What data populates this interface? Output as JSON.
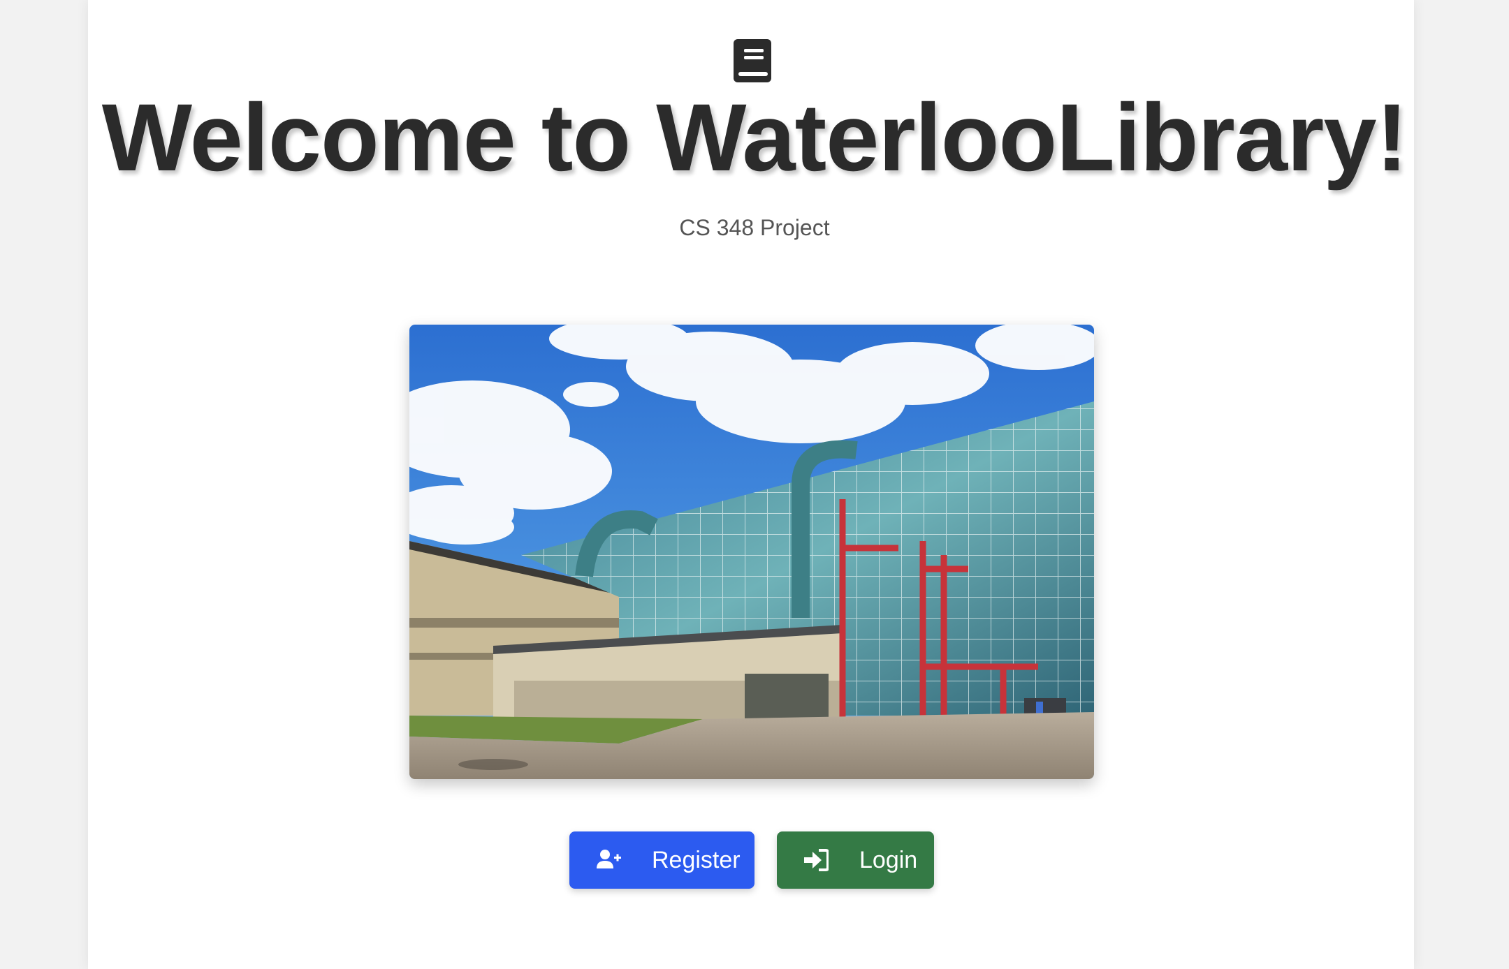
{
  "header": {
    "logo_icon": "book-icon",
    "title": "Welcome to WaterlooLibrary!",
    "subtitle": "CS 348 Project"
  },
  "hero_image": {
    "description_icon": "library-building-photo"
  },
  "actions": {
    "register_label": "Register",
    "register_icon": "user-plus-icon",
    "login_label": "Login",
    "login_icon": "sign-in-icon"
  },
  "colors": {
    "register": "#2c5bf0",
    "login": "#347a45",
    "title": "#2b2b2b"
  }
}
